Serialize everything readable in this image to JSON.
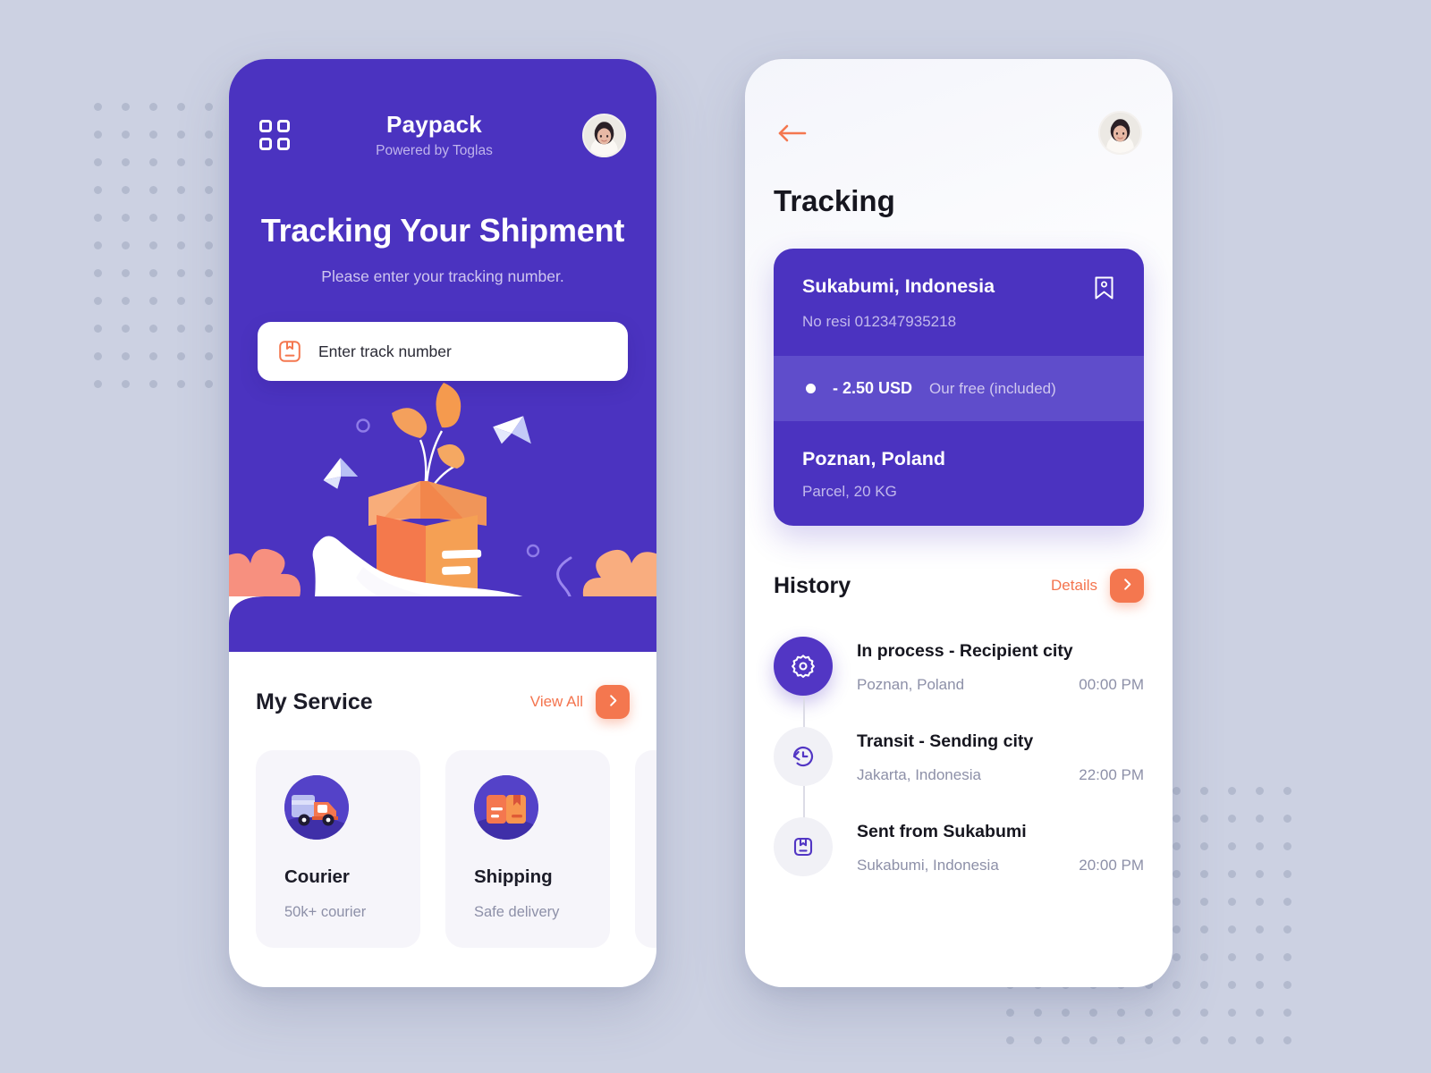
{
  "theme": {
    "page_background": "#ccd1e2",
    "primary_purple": "#4b33c0",
    "accent_orange": "#f4774f",
    "muted_text": "#8d90a8"
  },
  "left_phone": {
    "header": {
      "grid_icon": "grid-menu-icon",
      "brand_title": "Paypack",
      "brand_subtitle": "Powered by Toglas",
      "avatar": "user-avatar"
    },
    "hero": {
      "heading": "Tracking Your Shipment",
      "subheading": "Please enter your tracking number.",
      "search": {
        "icon": "package-icon",
        "placeholder": "Enter track number",
        "value": ""
      },
      "illustration": "hand-holding-open-box-with-plant"
    },
    "service": {
      "title": "My Service",
      "view_all_label": "View All",
      "view_all_icon": "chevron-right-icon",
      "cards": [
        {
          "icon": "delivery-truck-icon",
          "name": "Courier",
          "desc": "50k+ courier"
        },
        {
          "icon": "package-box-icon",
          "name": "Shipping",
          "desc": "Safe delivery"
        }
      ]
    }
  },
  "right_phone": {
    "header": {
      "back_icon": "arrow-left-icon",
      "avatar": "user-avatar"
    },
    "page_title": "Tracking",
    "tracking_card": {
      "origin_city": "Sukabumi, Indonesia",
      "receipt_label": "No resi 012347935218",
      "bookmark_icon": "bookmark-icon",
      "price": "- 2.50 USD",
      "price_note": "Our free (included)",
      "destination_city": "Poznan, Poland",
      "parcel_info": "Parcel, 20 KG"
    },
    "history": {
      "title": "History",
      "details_label": "Details",
      "details_icon": "chevron-right-icon",
      "items": [
        {
          "icon": "gear-icon",
          "active": true,
          "title": "In process - Recipient city",
          "place": "Poznan, Poland",
          "time": "00:00 PM"
        },
        {
          "icon": "history-clock-icon",
          "active": false,
          "title": "Transit - Sending city",
          "place": "Jakarta, Indonesia",
          "time": "22:00 PM"
        },
        {
          "icon": "package-icon",
          "active": false,
          "title": "Sent from Sukabumi",
          "place": "Sukabumi, Indonesia",
          "time": "20:00 PM"
        }
      ]
    }
  }
}
